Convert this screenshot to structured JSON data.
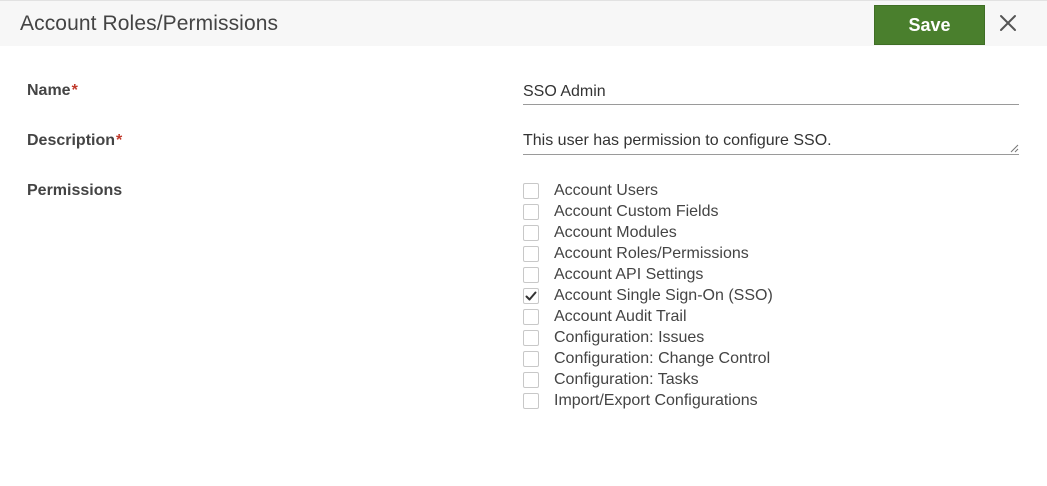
{
  "header": {
    "title": "Account Roles/Permissions",
    "save_label": "Save"
  },
  "form": {
    "name_label": "Name",
    "description_label": "Description",
    "permissions_label": "Permissions",
    "required_mark": "*",
    "name_value": "SSO Admin",
    "description_value": "This user has permission to configure SSO."
  },
  "permissions": [
    {
      "label": "Account Users",
      "checked": false
    },
    {
      "label": "Account Custom Fields",
      "checked": false
    },
    {
      "label": "Account Modules",
      "checked": false
    },
    {
      "label": "Account Roles/Permissions",
      "checked": false
    },
    {
      "label": "Account API Settings",
      "checked": false
    },
    {
      "label": "Account Single Sign-On (SSO)",
      "checked": true
    },
    {
      "label": "Account Audit Trail",
      "checked": false
    },
    {
      "label": "Configuration: Issues",
      "checked": false
    },
    {
      "label": "Configuration: Change Control",
      "checked": false
    },
    {
      "label": "Configuration: Tasks",
      "checked": false
    },
    {
      "label": "Import/Export Configurations",
      "checked": false
    }
  ],
  "colors": {
    "save_button": "#4a7f2d",
    "required": "#c0392b",
    "header_bg": "#f7f7f7"
  },
  "icons": {
    "close": "close-icon",
    "check": "checkmark-icon",
    "resize": "resize-handle-icon"
  }
}
